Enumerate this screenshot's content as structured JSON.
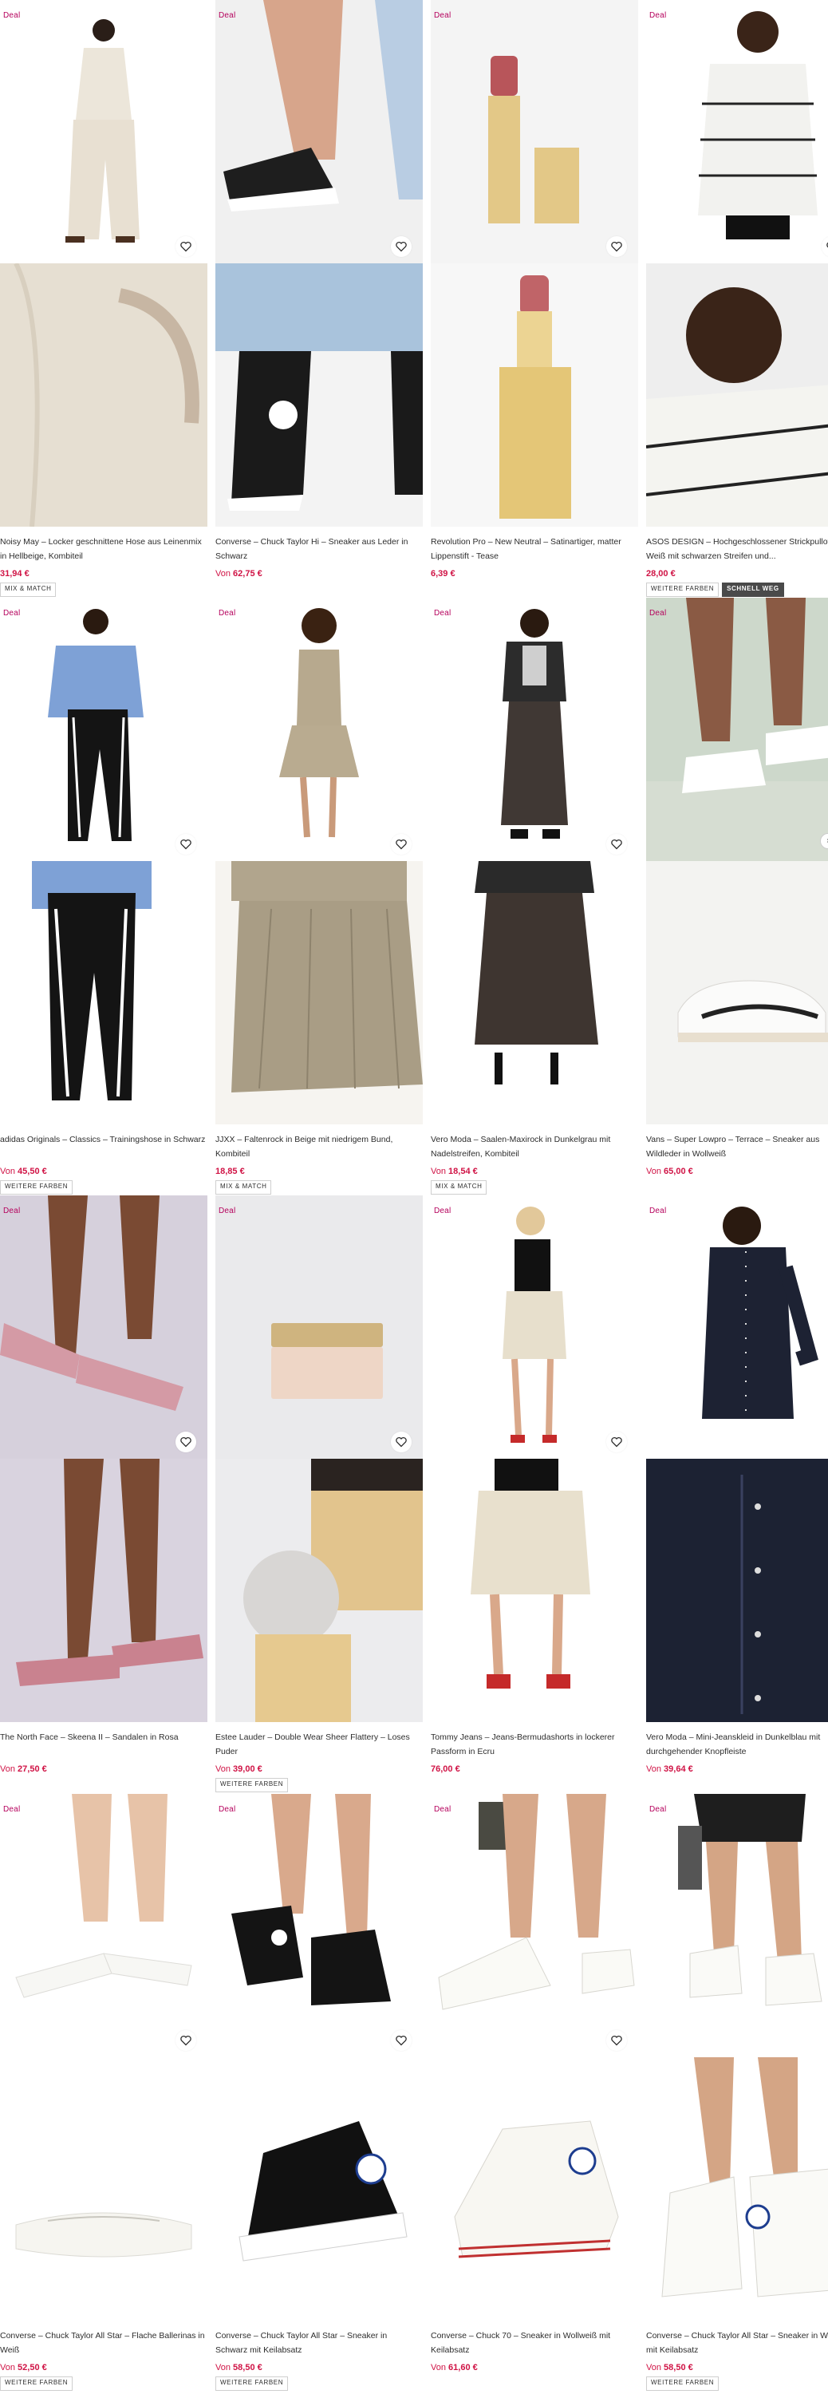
{
  "labels": {
    "deal": "Deal",
    "from": "Von"
  },
  "icons": {
    "save": "heart-icon"
  },
  "colors": {
    "deal": "#b5005c",
    "price": "#d01345",
    "badge_dark": "#4a4a4a"
  },
  "products": [
    {
      "deal": true,
      "title": "Noisy May – Locker geschnittene Hose aus Leinenmix in Hellbeige, Kombiteil",
      "price_from": "",
      "price": "31,94 €",
      "badges": [
        "MIX & MATCH"
      ]
    },
    {
      "deal": true,
      "title": "Converse – Chuck Taylor Hi – Sneaker aus Leder in Schwarz",
      "price_from": "Von",
      "price": "62,75 €",
      "badges": []
    },
    {
      "deal": true,
      "title": "Revolution Pro – New Neutral – Satinartiger, matter Lippenstift - Tease",
      "price_from": "",
      "price": "6,39 €",
      "badges": []
    },
    {
      "deal": true,
      "title": "ASOS DESIGN – Hochgeschlossener Strickpullover in Weiß mit schwarzen Streifen und...",
      "price_from": "",
      "price": "28,00 €",
      "badges": [
        "WEITERE FARBEN",
        "SCHNELL WEG"
      ]
    },
    {
      "deal": true,
      "title": "adidas Originals – Classics – Trainingshose in Schwarz",
      "price_from": "Von",
      "price": "45,50 €",
      "badges": [
        "WEITERE FARBEN"
      ]
    },
    {
      "deal": true,
      "title": "JJXX – Faltenrock in Beige mit niedrigem Bund, Kombiteil",
      "price_from": "",
      "price": "18,85 €",
      "badges": [
        "MIX & MATCH"
      ]
    },
    {
      "deal": true,
      "title": "Vero Moda – Saalen-Maxirock in Dunkelgrau mit Nadelstreifen, Kombiteil",
      "price_from": "Von",
      "price": "18,54 €",
      "badges": [
        "MIX & MATCH"
      ]
    },
    {
      "deal": true,
      "title": "Vans – Super Lowpro – Terrace – Sneaker aus Wildleder in Wollweiß",
      "price_from": "Von",
      "price": "65,00 €",
      "badges": []
    },
    {
      "deal": true,
      "title": "The North Face – Skeena II – Sandalen in Rosa",
      "price_from": "Von",
      "price": "27,50 €",
      "badges": []
    },
    {
      "deal": true,
      "title": "Estee Lauder – Double Wear Sheer Flattery – Loses Puder",
      "price_from": "Von",
      "price": "39,00 €",
      "badges": [
        "WEITERE FARBEN"
      ]
    },
    {
      "deal": true,
      "title": "Tommy Jeans – Jeans-Bermudashorts in lockerer Passform in Ecru",
      "price_from": "",
      "price": "76,00 €",
      "badges": []
    },
    {
      "deal": true,
      "title": "Vero Moda – Mini-Jeanskleid in Dunkelblau mit durchgehender Knopfleiste",
      "price_from": "Von",
      "price": "39,64 €",
      "badges": []
    },
    {
      "deal": true,
      "title": "Converse – Chuck Taylor All Star – Flache Ballerinas in Weiß",
      "price_from": "Von",
      "price": "52,50 €",
      "badges": [
        "WEITERE FARBEN"
      ]
    },
    {
      "deal": true,
      "title": "Converse – Chuck Taylor All Star – Sneaker in Schwarz mit Keilabsatz",
      "price_from": "Von",
      "price": "58,50 €",
      "badges": [
        "WEITERE FARBEN"
      ]
    },
    {
      "deal": true,
      "title": "Converse – Chuck 70 – Sneaker in Wollweiß mit Keilabsatz",
      "price_from": "Von",
      "price": "61,60 €",
      "badges": []
    },
    {
      "deal": true,
      "title": "Converse – Chuck Taylor All Star – Sneaker in Weiß mit Keilabsatz",
      "price_from": "Von",
      "price": "58,50 €",
      "badges": [
        "WEITERE FARBEN"
      ]
    }
  ]
}
